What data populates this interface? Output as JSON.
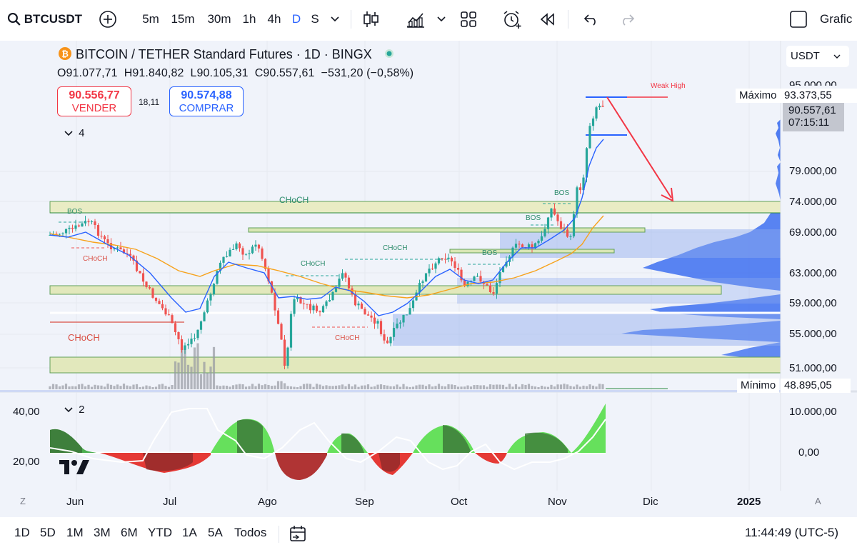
{
  "toolbar": {
    "symbol": "BTCUSDT",
    "intervals": [
      "5m",
      "15m",
      "30m",
      "1h",
      "4h",
      "D",
      "S"
    ],
    "active_interval": "D",
    "right_label": "Grafic"
  },
  "legend": {
    "title": "BITCOIN / TETHER Standard Futures · 1D · BINGX",
    "open": "O91.077,71",
    "high": "H91.840,82",
    "low": "L90.105,31",
    "close": "C90.557,61",
    "change": "−531,20 (−0,58%)"
  },
  "trade": {
    "sell_price": "90.556,77",
    "sell_label": "VENDER",
    "spread": "18,11",
    "buy_price": "90.574,88",
    "buy_label": "COMPRAR"
  },
  "indicators_collapsed": "4",
  "subpane_collapsed": "2",
  "currency_select": "USDT",
  "price_axis": [
    "79.000,00",
    "74.000,00",
    "69.000,00",
    "63.000,00",
    "59.000,00",
    "55.000,00",
    "51.000,00"
  ],
  "price_axis_partial": "95.000,00",
  "max_label": "Máximo",
  "max_value": "93.373,55",
  "last_price": "90.557,61",
  "countdown": "07:15:11",
  "min_label": "Mínimo",
  "min_value": "48.895,05",
  "sub_axis_left": [
    "40,00",
    "20,00"
  ],
  "sub_axis_right": [
    "10.000,00",
    "0,00"
  ],
  "annotations": {
    "choch": "CHoCH",
    "bos": "BOS",
    "weak_high": "Weak High"
  },
  "time_axis": {
    "z": "Z",
    "labels": [
      "Jun",
      "Jul",
      "Ago",
      "Sep",
      "Oct",
      "Nov",
      "Dic",
      "2025"
    ],
    "a": "A"
  },
  "ranges": [
    "1D",
    "5D",
    "1M",
    "3M",
    "6M",
    "YTD",
    "1A",
    "5A",
    "Todos"
  ],
  "clock": "11:44:49 (UTC-5)",
  "colors": {
    "up": "#26a69a",
    "down": "#ef5350",
    "blue": "#2962ff",
    "orange": "#f7a21b",
    "zone_yellow": "#f0f0c8",
    "zone_blue": "#8aa7ee"
  }
}
